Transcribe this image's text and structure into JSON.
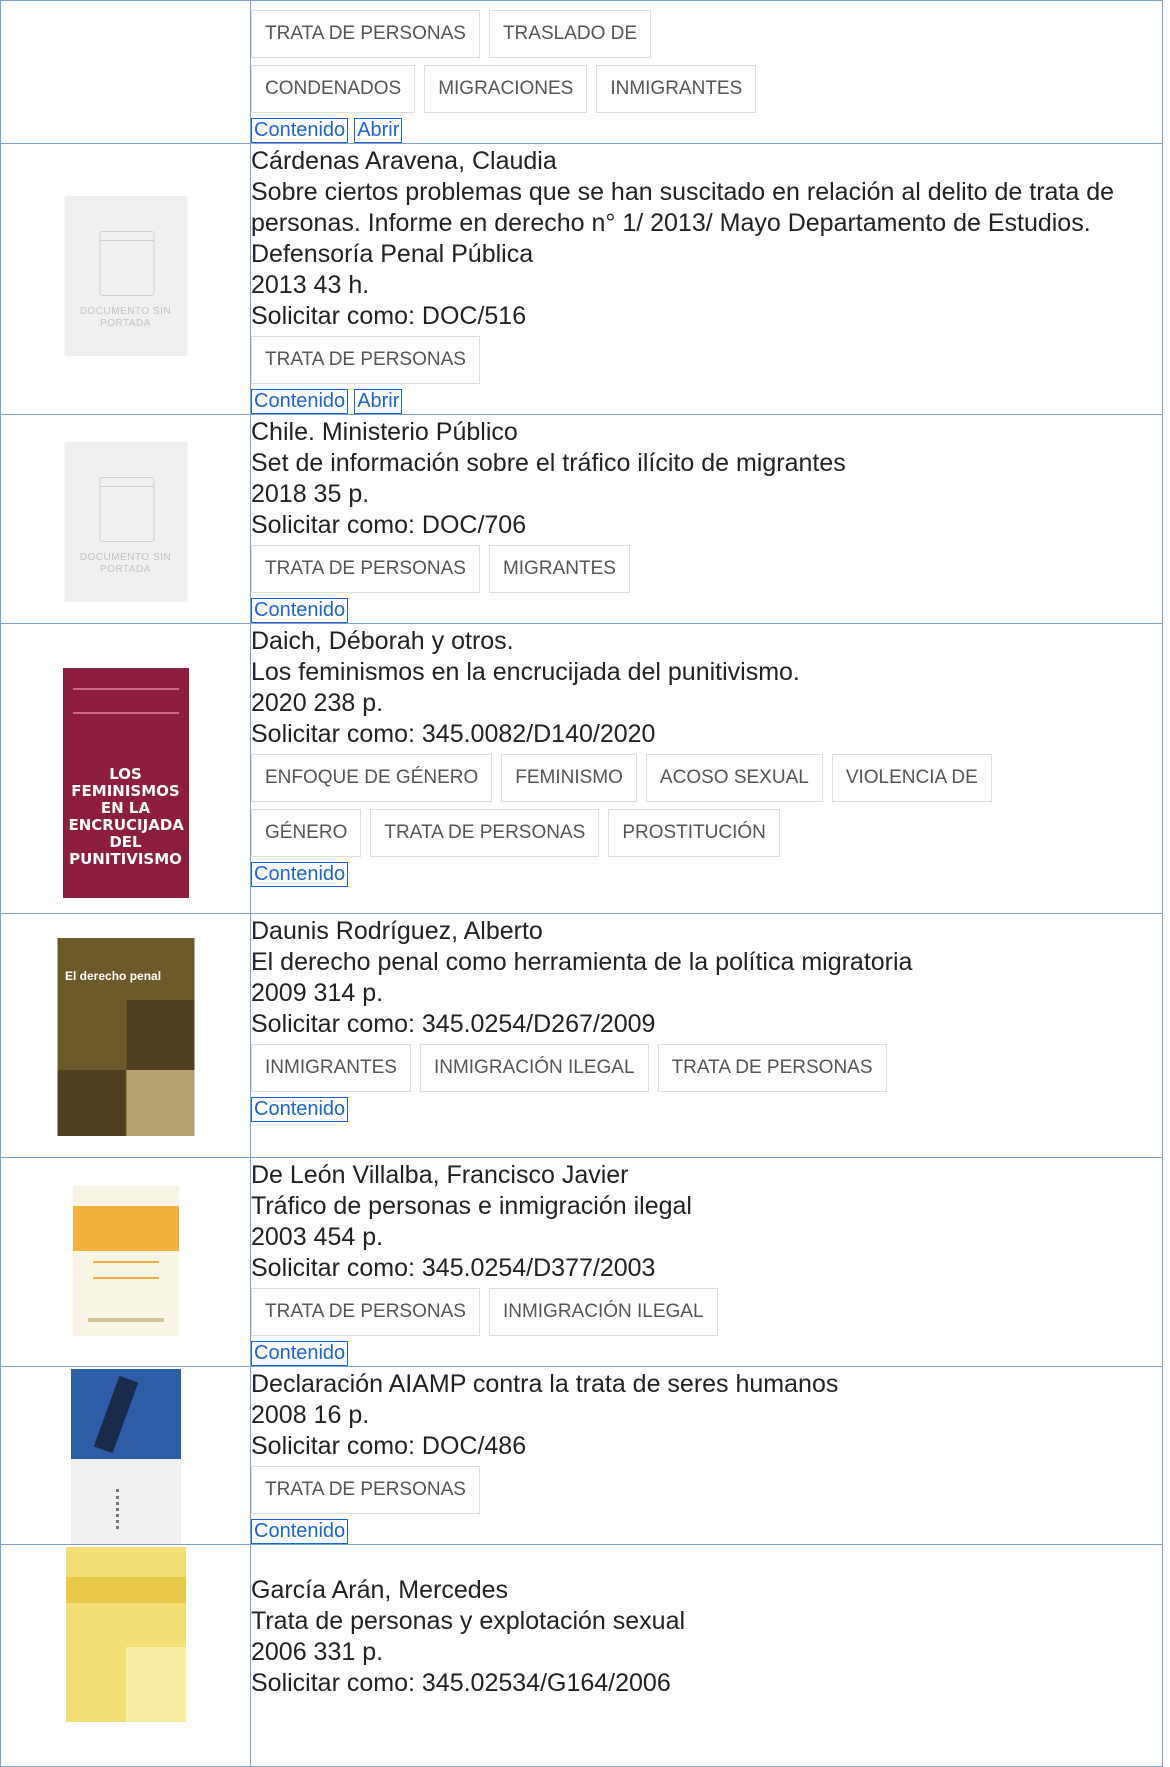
{
  "records": [
    {
      "author": "",
      "title": "",
      "year": "",
      "call": "",
      "tags": [
        "TRATA DE PERSONAS",
        "TRASLADO DE",
        "CONDENADOS",
        "MIGRACIONES",
        "INMIGRANTES"
      ],
      "links": {
        "contenido": "Contenido",
        "abrir": "Abrir"
      }
    },
    {
      "author": "Cárdenas Aravena, Claudia",
      "title": "Sobre ciertos problemas que se han suscitado en relación al delito de trata de personas. Informe en derecho n° 1/ 2013/ Mayo Departamento de Estudios. Defensoría Penal Pública",
      "year": "2013 43 h.",
      "call": "Solicitar como: DOC/516",
      "cover_label": "DOCUMENTO SIN PORTADA",
      "tags": [
        "TRATA DE PERSONAS"
      ],
      "links": {
        "contenido": "Contenido",
        "abrir": "Abrir"
      }
    },
    {
      "author": "Chile. Ministerio Público",
      "title": "Set de información sobre el tráfico ilícito de migrantes",
      "year": "2018 35 p.",
      "call": "Solicitar como: DOC/706",
      "cover_label": "DOCUMENTO SIN PORTADA",
      "tags": [
        "TRATA DE PERSONAS",
        "MIGRANTES"
      ],
      "links": {
        "contenido": "Contenido"
      }
    },
    {
      "author": "Daich, Déborah y otros.",
      "title": "Los feminismos en la encrucijada del punitivismo.",
      "year": "2020 238 p.",
      "call": "Solicitar como: 345.0082/D140/2020",
      "cover_text": "LOS FEMINISMOS EN LA ENCRUCIJADA DEL PUNITIVISMO",
      "tags": [
        "ENFOQUE DE GÉNERO",
        "FEMINISMO",
        "ACOSO SEXUAL",
        "VIOLENCIA DE",
        "GÉNERO",
        "TRATA DE PERSONAS",
        "PROSTITUCIÓN"
      ],
      "links": {
        "contenido": "Contenido"
      }
    },
    {
      "author": "Daunis Rodríguez, Alberto",
      "title": "El derecho penal como herramienta de la política migratoria",
      "year": "2009 314 p.",
      "call": "Solicitar como: 345.0254/D267/2009",
      "cover_text": "El derecho penal",
      "tags": [
        "INMIGRANTES",
        "INMIGRACIÓN ILEGAL",
        "TRATA DE PERSONAS"
      ],
      "links": {
        "contenido": "Contenido"
      }
    },
    {
      "author": "De León Villalba, Francisco Javier",
      "title": "Tráfico de personas e inmigración ilegal",
      "year": "2003 454 p.",
      "call": "Solicitar como: 345.0254/D377/2003",
      "tags": [
        "TRATA DE PERSONAS",
        "INMIGRACIÓN ILEGAL"
      ],
      "links": {
        "contenido": "Contenido"
      }
    },
    {
      "author": "",
      "title": "Declaración AIAMP contra la trata de seres humanos",
      "year": "2008 16 p.",
      "call": "Solicitar como: DOC/486",
      "tags": [
        "TRATA DE PERSONAS"
      ],
      "links": {
        "contenido": "Contenido"
      }
    },
    {
      "author": "García Arán, Mercedes",
      "title": "Trata de personas y explotación sexual",
      "year": "2006 331 p.",
      "call": "Solicitar como: 345.02534/G164/2006",
      "tags": [],
      "links": {}
    }
  ]
}
